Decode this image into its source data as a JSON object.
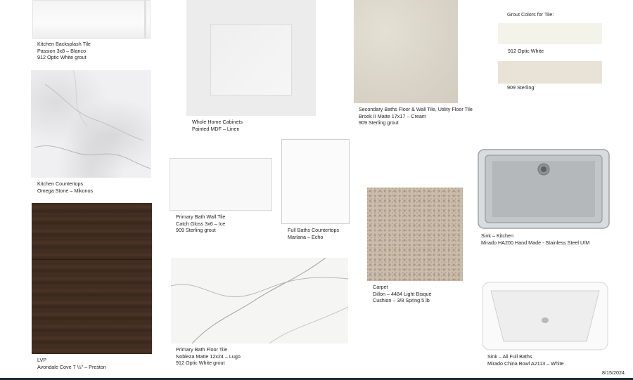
{
  "grout_header": "Grout Colors for Tile:",
  "date": "8/15/2024",
  "swatches": {
    "backsplash": [
      "Kitchen Backsplash Tile",
      "Passion 3x8 – Blanco",
      "912 Optic White grout"
    ],
    "cabinets": [
      "Whole Home Cabinets",
      "Painted MDF – Linen"
    ],
    "secondary_baths": [
      "Secondary Baths Floor & Wall Tile, Utility Floor Tile",
      "Brook II Matte 17x17 – Cream",
      "909 Sterling grout"
    ],
    "grout_optic_white": "912 Optic White",
    "grout_sterling": "909 Sterling",
    "countertops": [
      "Kitchen Countertops",
      "Omega Stone – Mikonos"
    ],
    "bath_wall": [
      "Primary Bath Wall Tile",
      "Catch Gloss 3x6 – Ice",
      "909 Sterling grout"
    ],
    "full_baths": [
      "Full Baths Countertops",
      "Marlana – Echo"
    ],
    "sink_kitchen": [
      "Sink – Kitchen",
      "Mirado HA200 Hand Made - Stainless Steel U/M"
    ],
    "carpet": [
      "Carpet",
      "Dillon – 4484 Light Bisque",
      "Cushion – 3/8 Spring 5 lb"
    ],
    "lvp": [
      "LVP",
      "Avondale Cove 7 ½\" – Preston"
    ],
    "bath_floor": [
      "Primary Bath Floor Tile",
      "Nobleza Matte 12x24 – Lugo",
      "912 Optic White grout"
    ],
    "sink_baths": [
      "Sink – All Full Baths",
      "Mirado China Bowl A2113 – White"
    ]
  }
}
